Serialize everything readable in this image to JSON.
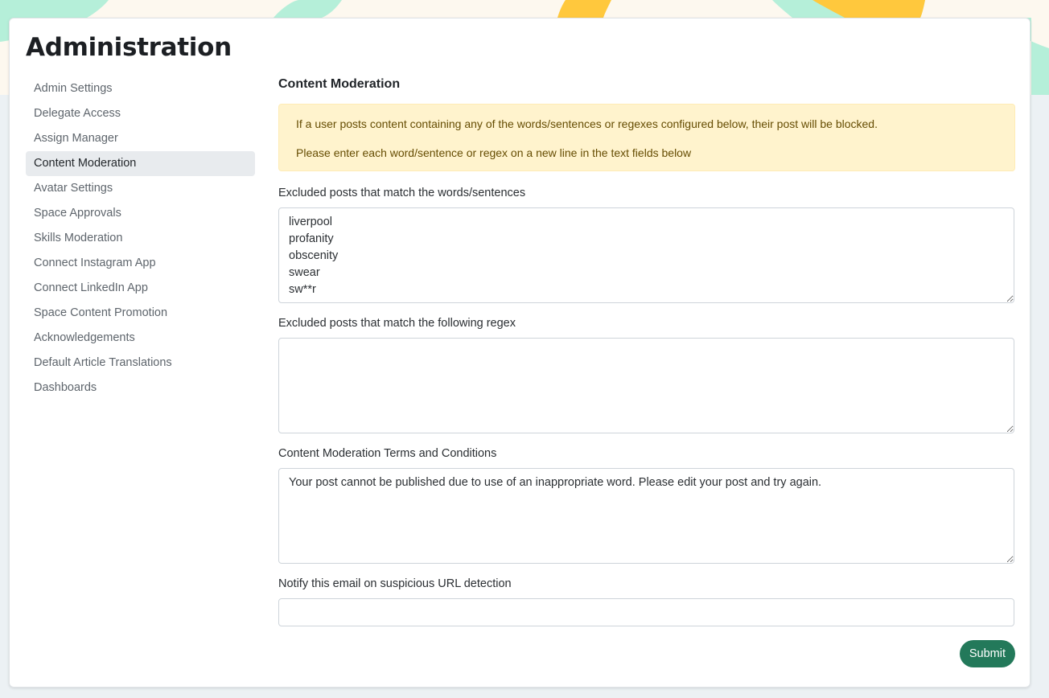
{
  "header": {
    "title": "Administration"
  },
  "sidebar": {
    "items": [
      {
        "label": "Admin Settings"
      },
      {
        "label": "Delegate Access"
      },
      {
        "label": "Assign Manager"
      },
      {
        "label": "Content Moderation",
        "active": true
      },
      {
        "label": "Avatar Settings"
      },
      {
        "label": "Space Approvals"
      },
      {
        "label": "Skills Moderation"
      },
      {
        "label": "Connect Instagram App"
      },
      {
        "label": "Connect LinkedIn App"
      },
      {
        "label": "Space Content Promotion"
      },
      {
        "label": "Acknowledgements"
      },
      {
        "label": "Default Article Translations"
      },
      {
        "label": "Dashboards"
      }
    ]
  },
  "main": {
    "title": "Content Moderation",
    "alert": {
      "line1": "If a user posts content containing any of the words/sentences or regexes configured below, their post will be blocked.",
      "line2": "Please enter each word/sentence or regex on a new line in the text fields below"
    },
    "fields": {
      "words": {
        "label": "Excluded posts that match the words/sentences",
        "value": "liverpool\nprofanity\nobscenity\nswear\nsw**r"
      },
      "regex": {
        "label": "Excluded posts that match the following regex",
        "value": ""
      },
      "terms": {
        "label": "Content Moderation Terms and Conditions",
        "value": "Your post cannot be published due to use of an inappropriate word. Please edit your post and try again."
      },
      "email": {
        "label": "Notify this email on suspicious URL detection",
        "value": ""
      }
    },
    "submit_label": "Submit"
  },
  "colors": {
    "accent": "#23795a",
    "alert_bg": "#fff3cd",
    "alert_text": "#664d03",
    "active_bg": "#e8ebee"
  }
}
